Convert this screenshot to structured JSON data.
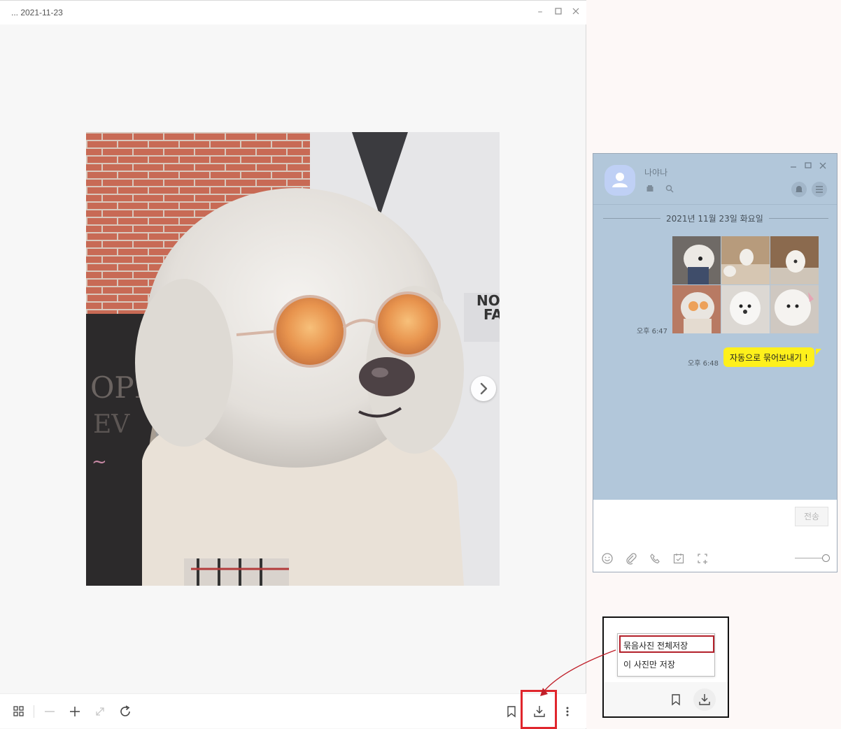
{
  "viewer": {
    "title": "... 2021-11-23"
  },
  "chat": {
    "name": "나야나",
    "date_divider": "2021년 11월 23일 화요일",
    "messages": [
      {
        "type": "photo_group",
        "time": "오후 6:47",
        "photo_count": 6
      },
      {
        "type": "text",
        "time": "오후 6:48",
        "text": "자동으로 묶어보내기 !"
      }
    ],
    "send_label": "전송"
  },
  "save_menu": {
    "items": [
      "묶음사진 전체저장",
      "이 사진만 저장"
    ],
    "highlighted_index": 0
  },
  "colors": {
    "chat_bg": "#b2c7da",
    "bubble": "#fef01b",
    "highlight": "#e0262d"
  }
}
